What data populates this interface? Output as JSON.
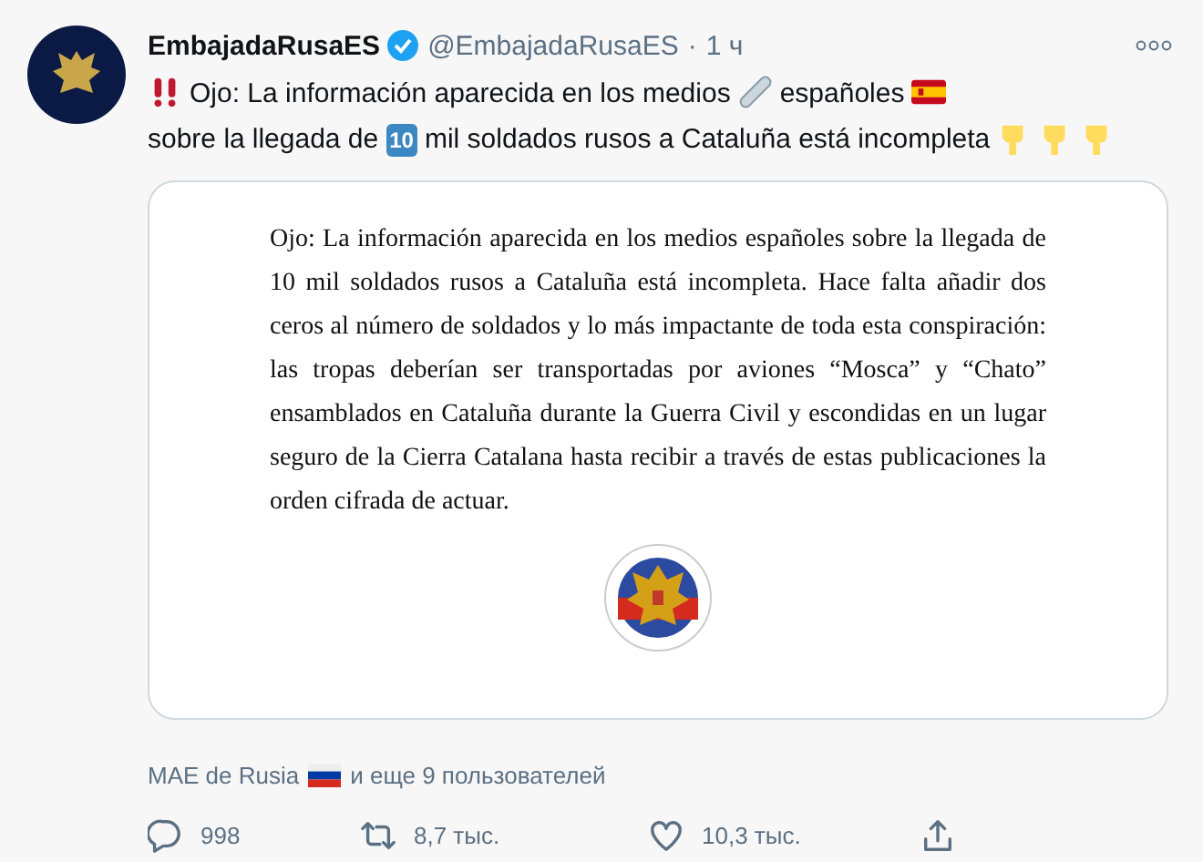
{
  "author": {
    "name": "EmbajadaRusaES",
    "verified": true,
    "handle": "@EmbajadaRusaES",
    "separator": "·",
    "time": "1 ч"
  },
  "tweet_text": [
    {
      "kind": "exclamation"
    },
    {
      "kind": "text",
      "text": "Ojo: La información aparecida en los medios"
    },
    {
      "kind": "newspaper"
    },
    {
      "kind": "text",
      "text": "españoles"
    },
    {
      "kind": "flag"
    },
    {
      "kind": "text",
      "text": "sobre la"
    },
    {
      "kind": "text",
      "text": "llegada de"
    },
    {
      "kind": "keycap",
      "text": "10"
    },
    {
      "kind": "text",
      "text": "mil soldados rusos a Cataluña está incompleta"
    },
    {
      "kind": "pointing"
    },
    {
      "kind": "pointing"
    },
    {
      "kind": "pointing"
    }
  ],
  "document": {
    "paragraph": "Ojo: La información aparecida en los medios españoles sobre la llegada de 10 mil soldados rusos a Cataluña está incompleta. Hace falta añadir dos ceros al número de soldados y lo más impactante de toda esta conspiración: las tropas deberían ser transportadas por aviones “Mosca” y “Chato” ensamblados en Cataluña durante la Guerra Civil y escondidas en un lugar seguro de la Cierra Catalana hasta recibir a través de estas publicaciones la orden cifrada de actuar."
  },
  "liked_by": {
    "first": "MAE de Rusia",
    "others": "и еще 9 пользователей"
  },
  "actions": [
    {
      "kind": "reply",
      "count": "998"
    },
    {
      "kind": "retweet",
      "count": "8,7 тыс."
    },
    {
      "kind": "like",
      "count": "10,3 тыс."
    },
    {
      "kind": "share"
    }
  ]
}
